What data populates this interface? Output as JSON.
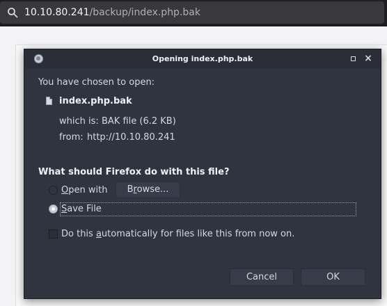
{
  "urlbar": {
    "host": "10.10.80.241",
    "path": "/backup/index.php.bak"
  },
  "dialog": {
    "title": "Opening index.php.bak",
    "intro": "You have chosen to open:",
    "filename": "index.php.bak",
    "which_is_label": "which is:",
    "which_is_value": "BAK file (6.2 KB)",
    "from_label": "from:",
    "from_value": "http://10.10.80.241",
    "question": "What should Firefox do with this file?",
    "open_with_label": "Open with",
    "browse_label": "Browse...",
    "save_file_label": "Save File",
    "save_file_selected": true,
    "auto_checkbox_label": "Do this automatically for files like this from now on.",
    "auto_checkbox_checked": false,
    "cancel_label": "Cancel",
    "ok_label": "OK"
  }
}
